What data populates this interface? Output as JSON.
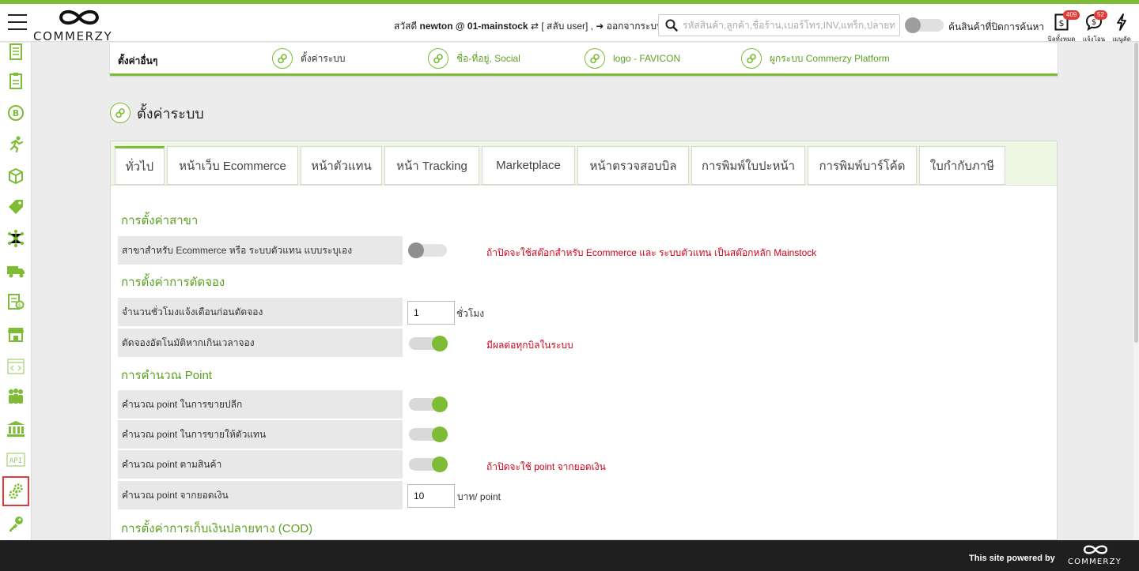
{
  "header": {
    "logo_text": "COMMERZY",
    "greeting_prefix": "สวัสดี",
    "greeting_user": "newton @ 01-mainstock",
    "switch_user": "[ สลับ user]",
    "logout": "ออกจากระบบ",
    "search_placeholder": "รหัสสินค้า,ลูกค้า,ชื่อร้าน,เบอร์โทร,INV,แทร็ก,ปลายทาง",
    "toggle_label": "ค้นสินค้าที่ปิดการค้นหา",
    "bills_label": "บิลทั้งหมด",
    "bills_count": "409",
    "notify_label": "แจ้งโอน",
    "notify_count": "52",
    "shortcut_label": "เมนูลัด"
  },
  "sidebar": {
    "icons": [
      "document-icon",
      "clipboard-icon",
      "baht-coin-icon",
      "runner-icon",
      "box-icon",
      "tag-icon",
      "network-icon",
      "truck-icon",
      "report-icon",
      "store-icon",
      "code-icon",
      "people-icon",
      "bank-icon",
      "api-icon",
      "settings-gears-icon",
      "key-icon"
    ],
    "active_index": 14
  },
  "subnav": {
    "title": "ตั้งค่าอื่นๆ",
    "links": [
      {
        "label": "ตั้งค่าระบบ",
        "style": "dark"
      },
      {
        "label": "ชื่อ-ที่อยู่, Social",
        "style": "green"
      },
      {
        "label": "logo - FAVICON",
        "style": "green"
      },
      {
        "label": "ผูกระบบ Commerzy Platform",
        "style": "green"
      }
    ]
  },
  "page": {
    "title": "ตั้งค่าระบบ"
  },
  "tabs": [
    "ทั่วไป",
    "หน้าเว็บ Ecommerce",
    "หน้าตัวแทน",
    "หน้า Tracking",
    "Marketplace",
    "หน้าตรวจสอบบิล",
    "การพิมพ์ใบปะหน้า",
    "การพิมพ์บาร์โค้ด",
    "ใบกำกับภาษี"
  ],
  "active_tab": "ทั่วไป",
  "sections": {
    "branch": {
      "heading": "การตั้งค่าสาขา",
      "row1_label": "สาขาสำหรับ Ecommerce หรือ ระบบตัวแทน แบบระบุเอง",
      "row1_toggle": "off",
      "row1_note": "ถ้าปิดจะใช้สต๊อกสำหรับ Ecommerce และ ระบบตัวแทน เป็นสต๊อกหลัก Mainstock"
    },
    "reservation": {
      "heading": "การตั้งค่าการตัดจอง",
      "row1_label": "จำนวนชั่วโมงแจ้งเตือนก่อนตัดจอง",
      "row1_value": "1",
      "row1_unit": "ชั่วโมง",
      "row2_label": "ตัดจองอัตโนมัติหากเกินเวลาจอง",
      "row2_toggle": "on",
      "row2_note": "มีผลต่อทุกบิลในระบบ"
    },
    "point": {
      "heading": "การคำนวณ Point",
      "row1_label": "คำนวณ point ในการขายปลีก",
      "row1_toggle": "on",
      "row2_label": "คำนวณ point ในการขายให้ตัวแทน",
      "row2_toggle": "on",
      "row3_label": "คำนวณ point ตามสินค้า",
      "row3_toggle": "on",
      "row3_note": "ถ้าปิดจะใช้ point จากยอดเงิน",
      "row4_label": "คำนวณ point จากยอดเงิน",
      "row4_value": "10",
      "row4_unit": "บาท/ point"
    },
    "cod": {
      "heading": "การตั้งค่าการเก็บเงินปลายทาง (COD)"
    }
  },
  "footer": {
    "powered_by": "This site powered by",
    "logo_text": "COMMERZY"
  },
  "colors": {
    "brand_green": "#7dbc34",
    "heading_green": "#5aa021",
    "note_red": "#d0021b",
    "badge_red": "#e53935"
  }
}
